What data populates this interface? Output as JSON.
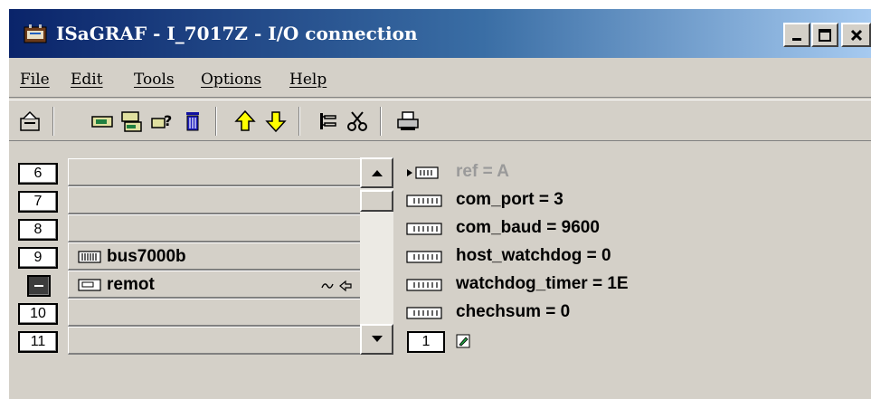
{
  "window": {
    "title": "ISaGRAF - I_7017Z - I/O connection",
    "controls": {
      "minimize": "_",
      "maximize": "□",
      "close": "×"
    }
  },
  "menu": [
    "File",
    "Edit",
    "Tools",
    "Options",
    "Help"
  ],
  "toolbar": {
    "icons": [
      "open-icon",
      "board-icon",
      "board-info-icon",
      "board-params-icon",
      "trash-icon",
      "arrow-up-icon",
      "arrow-down-icon",
      "connect-icon",
      "cut-icon",
      "print-icon"
    ]
  },
  "slots": [
    {
      "num": "6",
      "label": ""
    },
    {
      "num": "7",
      "label": ""
    },
    {
      "num": "8",
      "label": ""
    },
    {
      "num": "9",
      "label": "bus7000b",
      "icon": "equipment-icon"
    },
    {
      "num": "-",
      "label": "remot",
      "icon": "board-icon",
      "selected": true,
      "extra": "∿ ⇦"
    },
    {
      "num": "10",
      "label": ""
    },
    {
      "num": "11",
      "label": ""
    }
  ],
  "scrollbar": {
    "up": "▲",
    "down": "▼"
  },
  "params": [
    {
      "text": "ref = A",
      "gray": true,
      "icon": "ref-icon"
    },
    {
      "text": "com_port = 3",
      "icon": "param-icon"
    },
    {
      "text": "com_baud = 9600",
      "icon": "param-icon"
    },
    {
      "text": "host_watchdog = 0",
      "icon": "param-icon"
    },
    {
      "text": "watchdog_timer = 1E",
      "icon": "param-icon"
    },
    {
      "text": "chechsum = 0",
      "icon": "param-icon"
    }
  ],
  "channel": {
    "num": "1"
  }
}
